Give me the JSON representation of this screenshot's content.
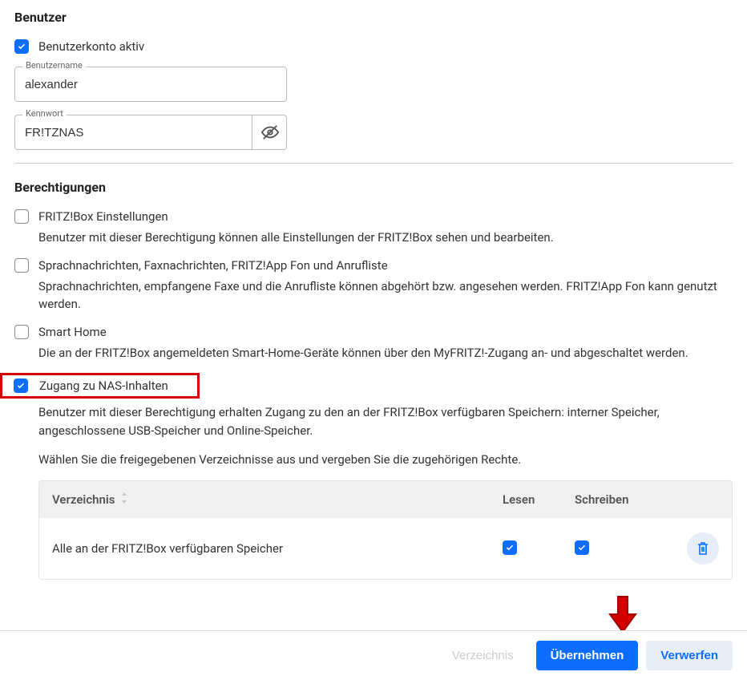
{
  "sections": {
    "user": "Benutzer",
    "perms": "Berechtigungen"
  },
  "user": {
    "active_label": "Benutzerkonto aktiv",
    "username_label": "Benutzername",
    "username_value": "alexander",
    "password_label": "Kennwort",
    "password_value": "FR!TZNAS"
  },
  "perms": [
    {
      "label": "FRITZ!Box Einstellungen",
      "desc": "Benutzer mit dieser Berechtigung können alle Einstellungen der FRITZ!Box sehen und bearbeiten.",
      "checked": false
    },
    {
      "label": "Sprachnachrichten, Faxnachrichten, FRITZ!App Fon und Anrufliste",
      "desc": "Sprachnachrichten, empfangene Faxe und die Anrufliste können abgehört bzw. angesehen werden. FRITZ!App Fon kann genutzt werden.",
      "checked": false
    },
    {
      "label": "Smart Home",
      "desc": "Die an der FRITZ!Box angemeldeten Smart-Home-Geräte können über den MyFRITZ!-Zugang an- und abgeschaltet werden.",
      "checked": false
    },
    {
      "label": "Zugang zu NAS-Inhalten",
      "desc": "Benutzer mit dieser Berechtigung erhalten Zugang zu den an der FRITZ!Box verfügbaren Speichern: interner Speicher, angeschlossene USB-Speicher und Online-Speicher.",
      "checked": true
    }
  ],
  "nas": {
    "instruction": "Wählen Sie die freigegebenen Verzeichnisse aus und vergeben Sie die zugehörigen Rechte.",
    "col_dir": "Verzeichnis",
    "col_read": "Lesen",
    "col_write": "Schreiben",
    "row_label": "Alle an der FRITZ!Box verfügbaren Speicher",
    "row_read": true,
    "row_write": true
  },
  "footer": {
    "ghost": "Verzeichnis",
    "apply": "Übernehmen",
    "discard": "Verwerfen"
  }
}
